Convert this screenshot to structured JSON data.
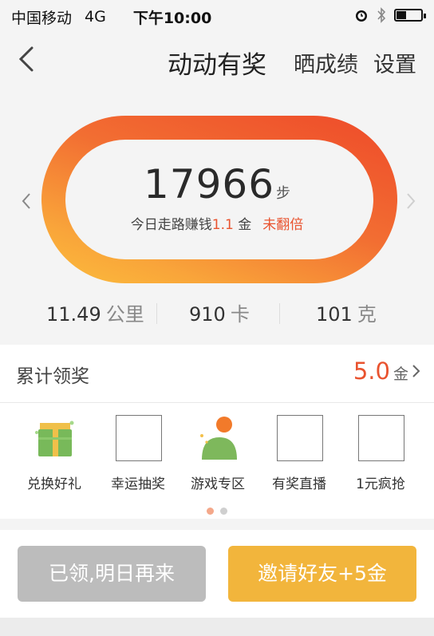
{
  "status_bar": {
    "signal": "●●●○○",
    "carrier": "中国移动",
    "network": "4G",
    "time": "下午10:00",
    "icons": [
      "alarm-icon",
      "bluetooth-icon",
      "battery-icon"
    ]
  },
  "navbar": {
    "title": "动动有奖",
    "actions": [
      "晒成绩",
      "设置"
    ]
  },
  "steps": {
    "count": "17966",
    "unit": "步",
    "subtitle_prefix": "今日走路赚钱",
    "coins": "1.1",
    "coins_unit": " 金",
    "double_status": "未翻倍"
  },
  "stats": [
    {
      "value": "11.49",
      "unit": "公里"
    },
    {
      "value": "910",
      "unit": "卡"
    },
    {
      "value": "101",
      "unit": "克"
    }
  ],
  "rewards": {
    "label": "累计领奖",
    "amount": "5.0",
    "unit": "金"
  },
  "grid_items": [
    {
      "label": "兑换好礼",
      "icon": "gift-icon"
    },
    {
      "label": "幸运抽奖",
      "icon": "placeholder-icon"
    },
    {
      "label": "游戏专区",
      "icon": "game-avatar-icon"
    },
    {
      "label": "有奖直播",
      "icon": "placeholder-icon"
    },
    {
      "label": "1元疯抢",
      "icon": "placeholder-icon"
    }
  ],
  "buttons": {
    "claimed": "已领,明日再来",
    "invite": "邀请好友+5金"
  },
  "colors": {
    "accent": "#e9532f",
    "ring_start": "#ee4a2a",
    "ring_end": "#fbbd3c",
    "invite_button": "#f2b53c",
    "claimed_button": "#bcbcbc"
  }
}
